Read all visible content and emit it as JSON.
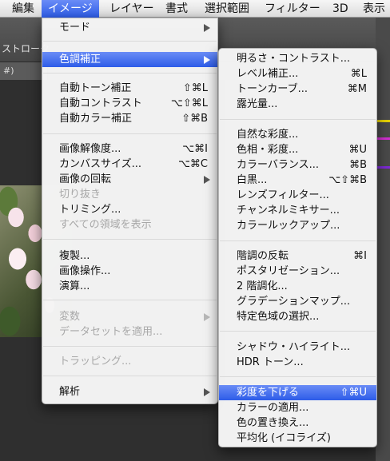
{
  "menubar": {
    "items": [
      {
        "label": "編集"
      },
      {
        "label": "イメージ"
      },
      {
        "label": "レイヤー"
      },
      {
        "label": "書式"
      },
      {
        "label": "選択範囲"
      },
      {
        "label": "フィルター"
      },
      {
        "label": "3D"
      },
      {
        "label": "表示"
      }
    ],
    "active_index": 1
  },
  "background": {
    "options_label": "ストローク",
    "tab_label": "#)"
  },
  "image_menu": {
    "items": [
      {
        "label": "モード",
        "shortcut": "",
        "submenu": true,
        "disabled": false,
        "highlight": false
      },
      {
        "label": "色調補正",
        "shortcut": "",
        "submenu": true,
        "disabled": false,
        "highlight": true
      },
      {
        "label": "自動トーン補正",
        "shortcut": "⇧⌘L",
        "submenu": false,
        "disabled": false,
        "highlight": false
      },
      {
        "label": "自動コントラスト",
        "shortcut": "⌥⇧⌘L",
        "submenu": false,
        "disabled": false,
        "highlight": false
      },
      {
        "label": "自動カラー補正",
        "shortcut": "⇧⌘B",
        "submenu": false,
        "disabled": false,
        "highlight": false
      },
      {
        "label": "画像解像度...",
        "shortcut": "⌥⌘I",
        "submenu": false,
        "disabled": false,
        "highlight": false
      },
      {
        "label": "カンバスサイズ...",
        "shortcut": "⌥⌘C",
        "submenu": false,
        "disabled": false,
        "highlight": false
      },
      {
        "label": "画像の回転",
        "shortcut": "",
        "submenu": true,
        "disabled": false,
        "highlight": false
      },
      {
        "label": "切り抜き",
        "shortcut": "",
        "submenu": false,
        "disabled": true,
        "highlight": false
      },
      {
        "label": "トリミング...",
        "shortcut": "",
        "submenu": false,
        "disabled": false,
        "highlight": false
      },
      {
        "label": "すべての領域を表示",
        "shortcut": "",
        "submenu": false,
        "disabled": true,
        "highlight": false
      },
      {
        "label": "複製...",
        "shortcut": "",
        "submenu": false,
        "disabled": false,
        "highlight": false
      },
      {
        "label": "画像操作...",
        "shortcut": "",
        "submenu": false,
        "disabled": false,
        "highlight": false
      },
      {
        "label": "演算...",
        "shortcut": "",
        "submenu": false,
        "disabled": false,
        "highlight": false
      },
      {
        "label": "変数",
        "shortcut": "",
        "submenu": true,
        "disabled": true,
        "highlight": false
      },
      {
        "label": "データセットを適用...",
        "shortcut": "",
        "submenu": false,
        "disabled": true,
        "highlight": false
      },
      {
        "label": "トラッピング...",
        "shortcut": "",
        "submenu": false,
        "disabled": true,
        "highlight": false
      },
      {
        "label": "解析",
        "shortcut": "",
        "submenu": true,
        "disabled": false,
        "highlight": false
      }
    ]
  },
  "adjustments_menu": {
    "items": [
      {
        "label": "明るさ・コントラスト...",
        "shortcut": "",
        "disabled": false,
        "highlight": false
      },
      {
        "label": "レベル補正...",
        "shortcut": "⌘L",
        "disabled": false,
        "highlight": false
      },
      {
        "label": "トーンカーブ...",
        "shortcut": "⌘M",
        "disabled": false,
        "highlight": false
      },
      {
        "label": "露光量...",
        "shortcut": "",
        "disabled": false,
        "highlight": false
      },
      {
        "label": "自然な彩度...",
        "shortcut": "",
        "disabled": false,
        "highlight": false
      },
      {
        "label": "色相・彩度...",
        "shortcut": "⌘U",
        "disabled": false,
        "highlight": false
      },
      {
        "label": "カラーバランス...",
        "shortcut": "⌘B",
        "disabled": false,
        "highlight": false
      },
      {
        "label": "白黒...",
        "shortcut": "⌥⇧⌘B",
        "disabled": false,
        "highlight": false
      },
      {
        "label": "レンズフィルター...",
        "shortcut": "",
        "disabled": false,
        "highlight": false
      },
      {
        "label": "チャンネルミキサー...",
        "shortcut": "",
        "disabled": false,
        "highlight": false
      },
      {
        "label": "カラールックアップ...",
        "shortcut": "",
        "disabled": false,
        "highlight": false
      },
      {
        "label": "階調の反転",
        "shortcut": "⌘I",
        "disabled": false,
        "highlight": false
      },
      {
        "label": "ポスタリゼーション...",
        "shortcut": "",
        "disabled": false,
        "highlight": false
      },
      {
        "label": "2 階調化...",
        "shortcut": "",
        "disabled": false,
        "highlight": false
      },
      {
        "label": "グラデーションマップ...",
        "shortcut": "",
        "disabled": false,
        "highlight": false
      },
      {
        "label": "特定色域の選択...",
        "shortcut": "",
        "disabled": false,
        "highlight": false
      },
      {
        "label": "シャドウ・ハイライト...",
        "shortcut": "",
        "disabled": false,
        "highlight": false
      },
      {
        "label": "HDR トーン...",
        "shortcut": "",
        "disabled": false,
        "highlight": false
      },
      {
        "label": "彩度を下げる",
        "shortcut": "⇧⌘U",
        "disabled": false,
        "highlight": true
      },
      {
        "label": "カラーの適用...",
        "shortcut": "",
        "disabled": false,
        "highlight": false
      },
      {
        "label": "色の置き換え...",
        "shortcut": "",
        "disabled": false,
        "highlight": false
      },
      {
        "label": "平均化 (イコライズ)",
        "shortcut": "",
        "disabled": false,
        "highlight": false
      }
    ]
  },
  "colors": {
    "highlight": "#3e6ff0",
    "menu_bg": "#f5f5f5",
    "disabled_text": "#a8a8a8",
    "app_bg": "#3b3b3b"
  }
}
